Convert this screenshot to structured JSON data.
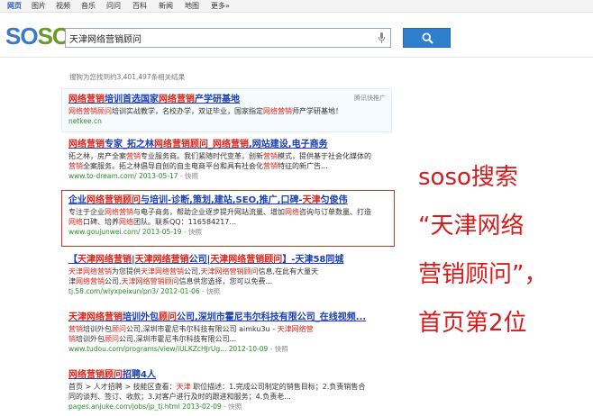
{
  "nav": {
    "items": [
      "网页",
      "图片",
      "视频",
      "音乐",
      "问问",
      "百科",
      "新闻",
      "地图",
      "更多»"
    ]
  },
  "logo": {
    "part1": "SO",
    "part2": "SO"
  },
  "search": {
    "query": "天津网络营销顾问",
    "button_icon": "search-icon"
  },
  "result_count": "搜狗为您找到约3,401,497条相关结果",
  "ad": {
    "label": "腾讯快推广"
  },
  "results": [
    {
      "title": "网络营销培训首选国家网络营销产业研基地",
      "desc1": "网络营销顾问培训实战教学，名校办学，双证毕业，国家指定网络营销师产学研基地！",
      "desc2": "",
      "url": "netkee.cn",
      "snapshot": ""
    },
    {
      "title": "网络营销专家_拓之林网络营销顾问_网络营销,网站建设,电子商务",
      "desc1": "拓之林，房产全案营销专业服务商。我们紧随时代变革，创新营销模式，提供基于社会化媒体的",
      "desc2": "营销全案服务。拓之林倡导自创的自主电商平台和具有社会化营销特征的新广告...",
      "url": "www.to-dream.com/ 2013-05-17",
      "snapshot": "- 快照"
    },
    {
      "title": "企业网络营销顾问与培训-诊断,策划,建站,SEO,推广,口碑-天津匀俊伟",
      "desc1": "专注于企业网络营销与电子商务，帮助企业逐步提升网站流量、增加网络咨询与订单数量、打造",
      "desc2": "网络口碑、培养网络团队。联系QQ：116584217...",
      "url": "www.goujunwei.com/ 2013-05-19",
      "snapshot": "- 快照"
    },
    {
      "title": "【天津网络营销|天津网络营销公司|天津网络营销顾问】-天津58同城",
      "desc1": "天津网络营销为您提供天津网络营销公司,天津网络营销顾问信息,在此有大量天",
      "desc2": "津网络营销公司,天津网络营销顾问信息供您选择，您可以免费...",
      "url": "tj.58.com/wlyxpeixun/pn3/ 2012-01-06",
      "snapshot": "- 快照"
    },
    {
      "title": "天津网络营销培训外包顾问公司,深圳市霍尼韦尔科技有限公司_在线视频...",
      "desc1": "营销培训外包顾问公司,深圳市霍尼韦尔科技有限公司 aimku3u - 天津网络营",
      "desc2": "销培训外包顾问公司,深圳市霍尼韦尔科技有限公司...",
      "url": "www.tudou.com/programs/view/iULKZcHJrUg... 2012-10-09",
      "snapshot": "- 快照"
    },
    {
      "title": "网络营销顾问招聘4人",
      "desc1": "首页 > 人才招聘 > 技能区查看：天津 职位描述：1.完成公司制定的销售目标；2.负责销售合",
      "desc2": "同的谈判、签订、收款；3.对客户进行及时的跟进和服务；4.负责老...",
      "url": "pages.anjuke.com/jobs/jp_tj.html 2013-02-09",
      "snapshot": "- 快照"
    }
  ],
  "caption": {
    "line1": "soso搜索",
    "line2": "“天津网络",
    "line3": "营销顾问”，",
    "line4": "首页第2位"
  }
}
